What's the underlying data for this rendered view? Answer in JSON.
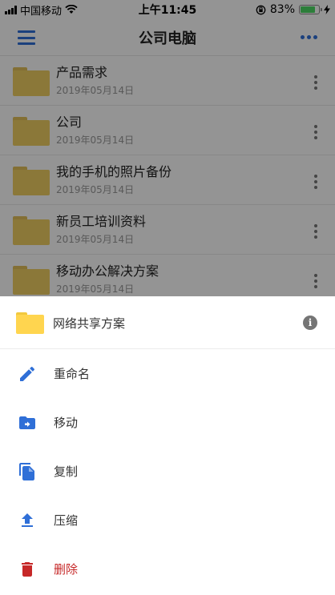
{
  "status_bar": {
    "carrier": "中国移动",
    "time": "上午11:45",
    "battery_percent": "83%",
    "battery_level": 0.83
  },
  "nav": {
    "title": "公司电脑"
  },
  "files": [
    {
      "name": "产品需求",
      "date": "2019年05月14日"
    },
    {
      "name": "公司",
      "date": "2019年05月14日"
    },
    {
      "name": "我的手机的照片备份",
      "date": "2019年05月14日"
    },
    {
      "name": "新员工培训资料",
      "date": "2019年05月14日"
    },
    {
      "name": "移动办公解决方案",
      "date": "2019年05月14日"
    }
  ],
  "sheet": {
    "title": "网络共享方案",
    "actions": [
      {
        "label": "重命名",
        "icon": "pencil-icon"
      },
      {
        "label": "移动",
        "icon": "folder-move-icon"
      },
      {
        "label": "复制",
        "icon": "copy-icon"
      },
      {
        "label": "压缩",
        "icon": "upload-icon"
      },
      {
        "label": "删除",
        "icon": "trash-icon"
      }
    ]
  },
  "colors": {
    "accent": "#2f6fd7",
    "danger": "#c62828",
    "folder": "#f0cf62"
  }
}
